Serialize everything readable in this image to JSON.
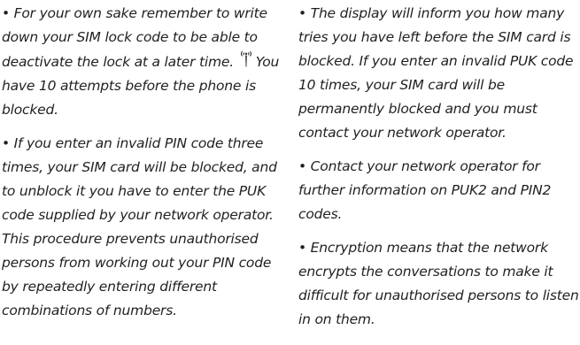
{
  "left_column": {
    "para1_before_icon": "• For your own sake remember to write down your SIM lock code to be able to deactivate the lock at a later time.",
    "para1_icon": "antenna-icon",
    "para1_after_icon": "You have 10 attempts before the phone is blocked.",
    "para2": "• If you enter an invalid PIN code three times, your SIM card will be blocked, and to unblock it you have to enter the PUK code supplied by your network operator. This procedure prevents unauthorised persons from working out your PIN code by repeatedly entering different combinations of numbers."
  },
  "right_column": {
    "para1": "• The display will inform you how many tries you have left before the SIM card is blocked. If you enter an invalid PUK code 10 times, your SIM card will be permanently blocked and you must contact your network operator.",
    "para2": "• Contact your network operator for further information on PUK2 and PIN2 codes.",
    "para3": "• Encryption means that the network encrypts the conversations to make it difficult for unauthorised persons to listen in on them."
  }
}
